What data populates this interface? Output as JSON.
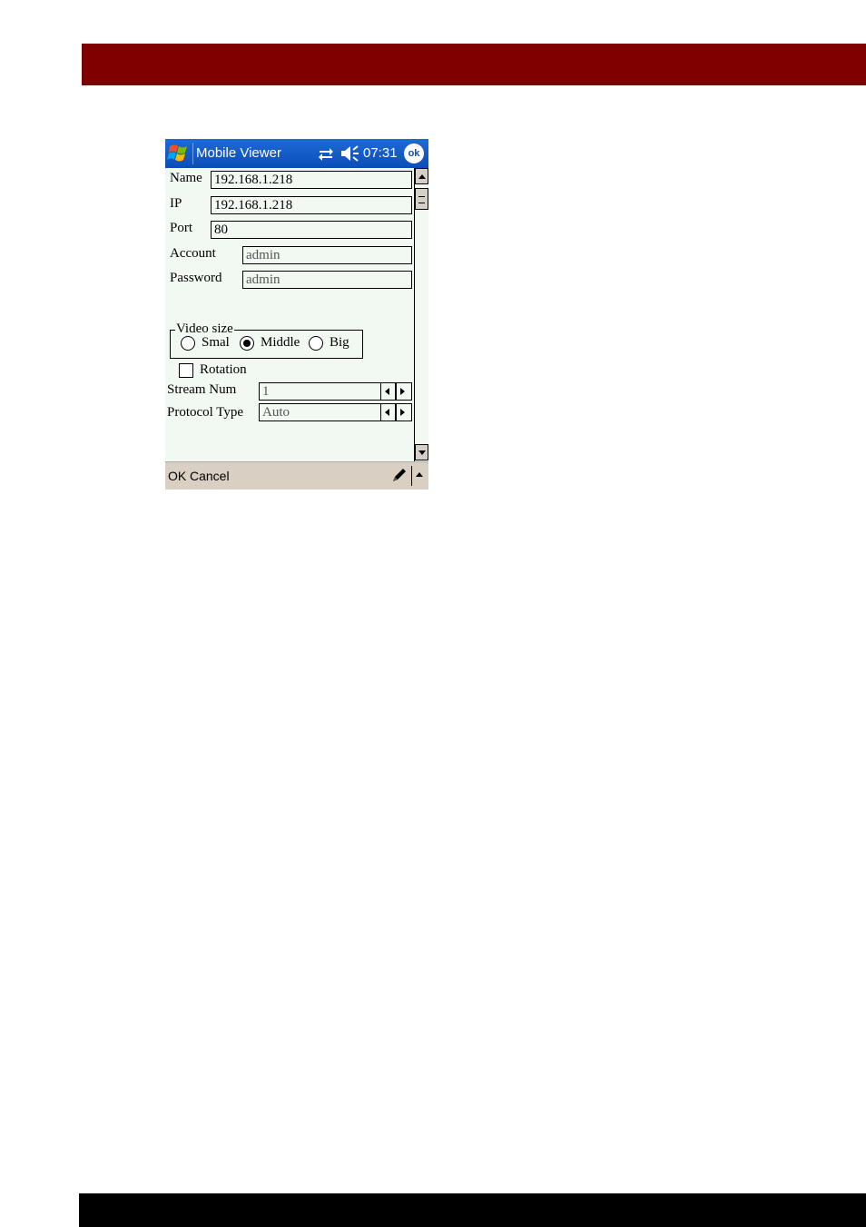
{
  "titlebar": {
    "title": "Mobile Viewer",
    "time": "07:31",
    "ok_label": "ok"
  },
  "form": {
    "name_label": "Name",
    "name_value": "192.168.1.218",
    "ip_label": "IP",
    "ip_value": "192.168.1.218",
    "port_label": "Port",
    "port_value": "80",
    "account_label": "Account",
    "account_value": "admin",
    "password_label": "Password",
    "password_value": "admin",
    "video_size": {
      "legend": "Video size",
      "options": [
        {
          "label": "Smal",
          "selected": false
        },
        {
          "label": "Middle",
          "selected": true
        },
        {
          "label": "Big",
          "selected": false
        }
      ]
    },
    "rotation_label": "Rotation",
    "rotation_checked": false,
    "stream_num_label": "Stream Num",
    "stream_num_value": "1",
    "protocol_type_label": "Protocol Type",
    "protocol_type_value": "Auto"
  },
  "menubar": {
    "ok_label": "OK",
    "cancel_label": "Cancel"
  },
  "colors": {
    "header_bar": "#800000",
    "footer_bar": "#000000",
    "titlebar": "#0b4db8",
    "form_bg": "#f2f9f2",
    "menubar": "#d9cfc3"
  }
}
